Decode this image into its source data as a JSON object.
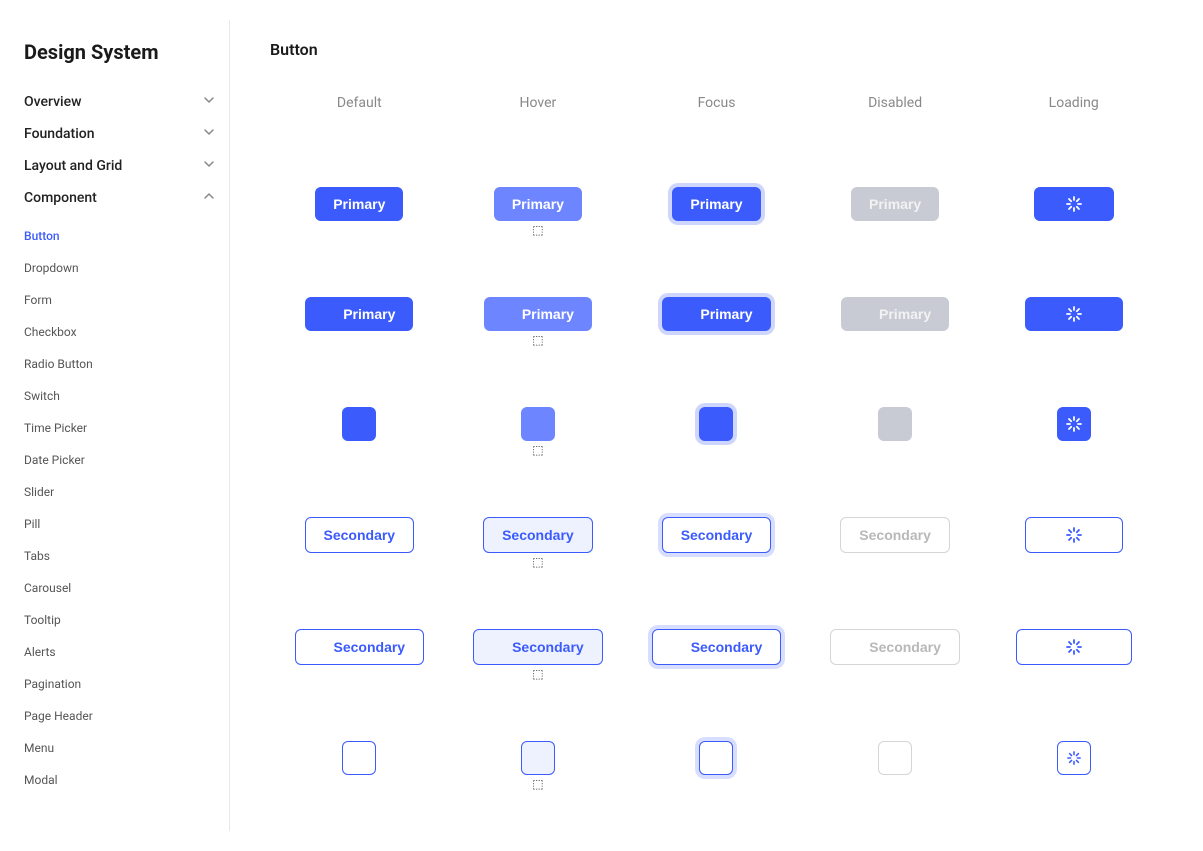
{
  "sidebar": {
    "title": "Design System",
    "sections": [
      {
        "label": "Overview",
        "open": false
      },
      {
        "label": "Foundation",
        "open": false
      },
      {
        "label": "Layout and Grid",
        "open": false
      },
      {
        "label": "Component",
        "open": true
      }
    ],
    "component_items": [
      {
        "label": "Button",
        "active": true
      },
      {
        "label": "Dropdown"
      },
      {
        "label": "Form"
      },
      {
        "label": "Checkbox"
      },
      {
        "label": "Radio Button"
      },
      {
        "label": "Switch"
      },
      {
        "label": "Time Picker"
      },
      {
        "label": "Date Picker"
      },
      {
        "label": "Slider"
      },
      {
        "label": "Pill"
      },
      {
        "label": "Tabs"
      },
      {
        "label": "Carousel"
      },
      {
        "label": "Tooltip"
      },
      {
        "label": "Alerts"
      },
      {
        "label": "Pagination"
      },
      {
        "label": "Page Header"
      },
      {
        "label": "Menu"
      },
      {
        "label": "Modal"
      }
    ]
  },
  "main": {
    "title": "Button",
    "columns": [
      "Default",
      "Hover",
      "Focus",
      "Disabled",
      "Loading"
    ],
    "labels": {
      "primary": "Primary",
      "secondary": "Secondary"
    },
    "colors": {
      "primary": "#3b5bfd",
      "primary_hover": "#6d85ff",
      "disabled_bg": "#c8cbd4",
      "secondary_disabled": "#b8b8b8"
    }
  }
}
